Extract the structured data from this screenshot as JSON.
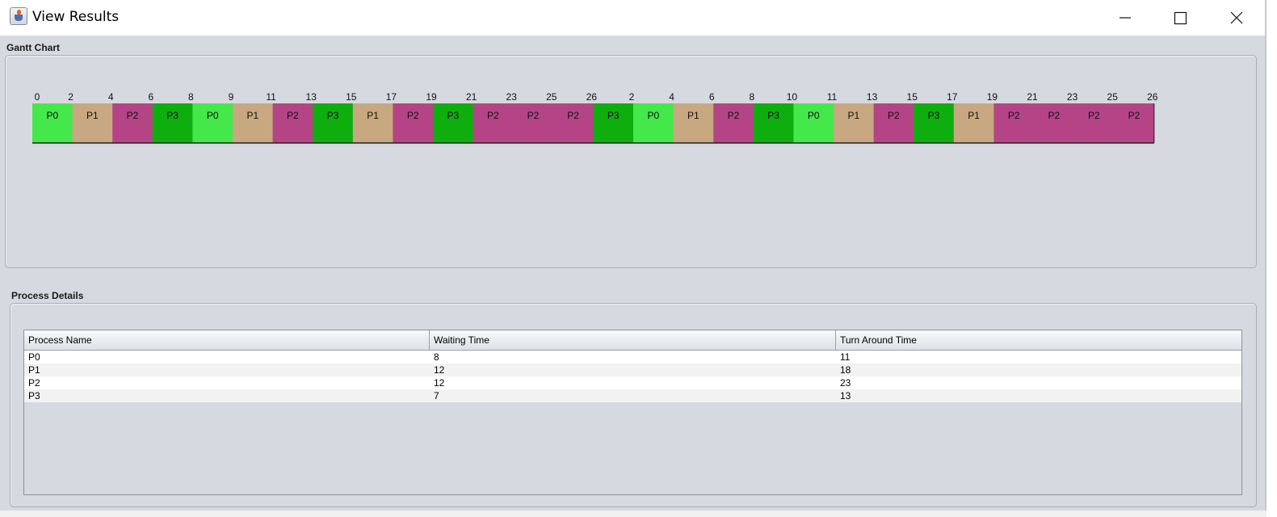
{
  "window": {
    "title": "View Results",
    "icon": "java-cup-icon",
    "controls": [
      "minimize-icon",
      "maximize-icon",
      "close-icon"
    ]
  },
  "gantt": {
    "title": "Gantt Chart",
    "colors": {
      "P0": "#45e84a",
      "P1": "#c8a880",
      "P2": "#b54487",
      "P3": "#0fae0f"
    },
    "blocks": [
      "P0",
      "P1",
      "P2",
      "P3",
      "P0",
      "P1",
      "P2",
      "P3",
      "P1",
      "P2",
      "P3",
      "P2",
      "P2",
      "P2",
      "P3",
      "P0",
      "P1",
      "P2",
      "P3",
      "P0",
      "P1",
      "P2",
      "P3",
      "P1",
      "P2",
      "P2",
      "P2",
      "P2"
    ],
    "ticks": [
      "0",
      "2",
      "4",
      "6",
      "8",
      "9",
      "11",
      "13",
      "15",
      "17",
      "19",
      "21",
      "23",
      "25",
      "26",
      "2",
      "4",
      "6",
      "8",
      "10",
      "11",
      "13",
      "15",
      "17",
      "19",
      "21",
      "23",
      "25",
      "26"
    ]
  },
  "details": {
    "title": "Process Details",
    "columns": [
      "Process Name",
      "Waiting Time",
      "Turn Around Time"
    ],
    "rows": [
      [
        "P0",
        "8",
        "11"
      ],
      [
        "P1",
        "12",
        "18"
      ],
      [
        "P2",
        "12",
        "23"
      ],
      [
        "P3",
        "7",
        "13"
      ]
    ]
  }
}
